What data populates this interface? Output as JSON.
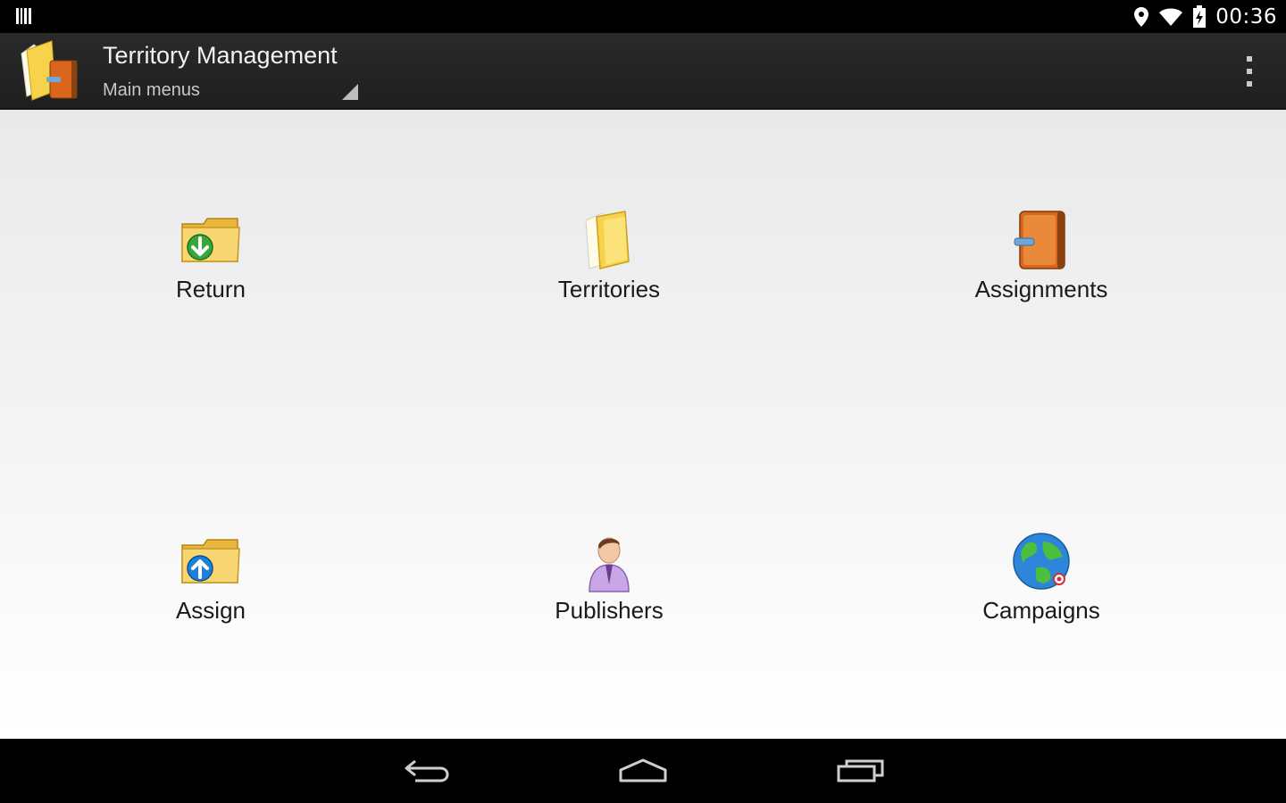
{
  "status_bar": {
    "time": "00:36",
    "left_icon": "barcode-icon",
    "right_icons": [
      "location-icon",
      "wifi-icon",
      "battery-charging-icon"
    ]
  },
  "action_bar": {
    "title": "Territory Management",
    "subtitle": "Main menus",
    "app_icon": "folder-book-icon",
    "overflow_icon": "overflow-menu-icon"
  },
  "menu": {
    "items": [
      {
        "label": "Return",
        "icon": "folder-download-icon"
      },
      {
        "label": "Territories",
        "icon": "folder-icon"
      },
      {
        "label": "Assignments",
        "icon": "book-icon"
      },
      {
        "label": "Assign",
        "icon": "folder-upload-icon"
      },
      {
        "label": "Publishers",
        "icon": "person-icon"
      },
      {
        "label": "Campaigns",
        "icon": "globe-icon"
      }
    ]
  },
  "nav_bar": {
    "buttons": [
      "back-icon",
      "home-icon",
      "recents-icon"
    ]
  },
  "colors": {
    "status_bar_bg": "#000000",
    "action_bar_bg": "#262626",
    "content_bg_top": "#e9e9e9",
    "content_bg_bottom": "#ffffff",
    "folder_yellow": "#f5c842",
    "green_arrow": "#3aa53a",
    "blue_arrow": "#1f7fd8",
    "book_orange": "#d9661c"
  }
}
